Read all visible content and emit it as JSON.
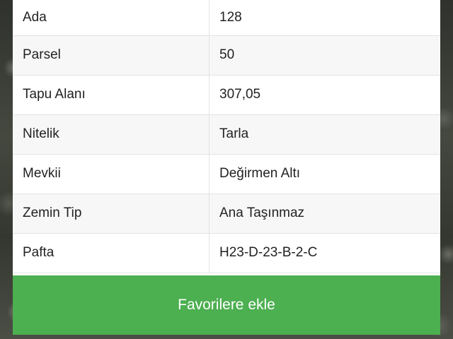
{
  "parcel_info": {
    "rows": [
      {
        "label": "Ada",
        "value": "128"
      },
      {
        "label": "Parsel",
        "value": "50"
      },
      {
        "label": "Tapu Alanı",
        "value": "307,05"
      },
      {
        "label": "Nitelik",
        "value": "Tarla"
      },
      {
        "label": "Mevkii",
        "value": "Değirmen Altı"
      },
      {
        "label": "Zemin Tip",
        "value": "Ana Taşınmaz"
      },
      {
        "label": "Pafta",
        "value": "H23-D-23-B-2-C"
      }
    ]
  },
  "actions": {
    "favorite_label": "Favorilere ekle",
    "favorite_color": "#4caf50"
  }
}
